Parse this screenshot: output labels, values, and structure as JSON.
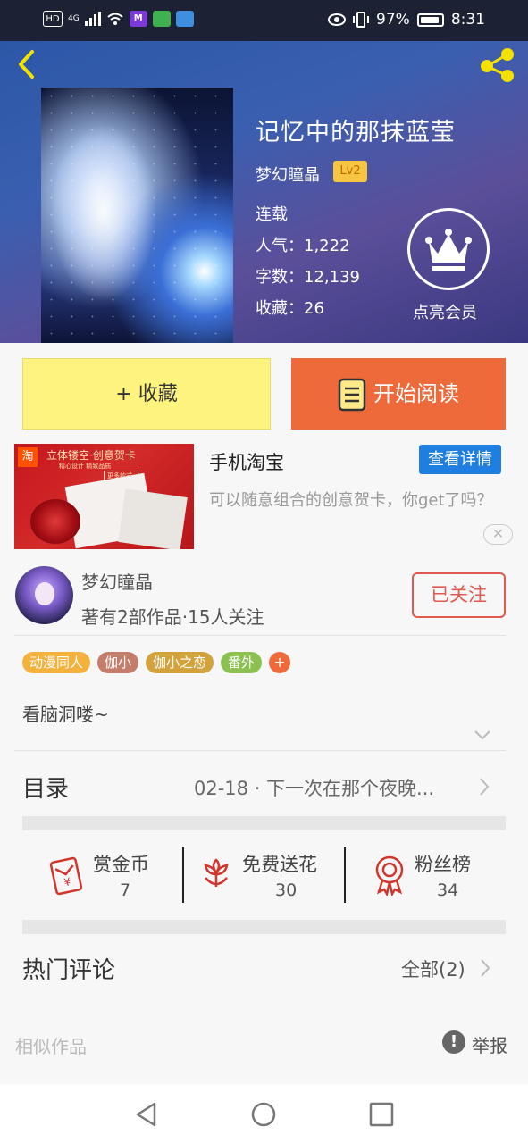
{
  "status_bar": {
    "network": "HD",
    "signal": "4G",
    "battery": "97%",
    "time": "8:31"
  },
  "book": {
    "title": "记忆中的那抹蓝莹",
    "author": "梦幻瞳晶",
    "level": "Lv2",
    "status": "连载",
    "popularity": "人气：1,222",
    "word_count": "字数：12,139",
    "favorites": "收藏：26",
    "vip_label": "点亮会员"
  },
  "actions": {
    "collect": "+ 收藏",
    "read": "开始阅读"
  },
  "ad": {
    "logo": "淘",
    "banner": "立体镂空·创意贺卡",
    "banner_sub": "精心设计  精致品质",
    "banner_more": "更多款式›",
    "title": "手机淘宝",
    "button": "查看详情",
    "description": "可以随意组合的创意贺卡，你get了吗？",
    "close": "✕"
  },
  "author_card": {
    "name": "梦幻瞳晶",
    "info": "著有2部作品·15人关注",
    "follow": "已关注"
  },
  "tags": [
    {
      "label": "动漫同人",
      "color": "#f4b23c"
    },
    {
      "label": "伽小",
      "color": "#c47d6a"
    },
    {
      "label": "伽小之恋",
      "color": "#d4a23c"
    },
    {
      "label": "番外",
      "color": "#8cc152"
    }
  ],
  "tag_add": "+",
  "description": "看脑洞喽~",
  "toc": {
    "label": "目录",
    "latest": "02-18 · 下一次在那个夜晚..."
  },
  "rewards": [
    {
      "label": "赏金币",
      "value": "7"
    },
    {
      "label": "免费送花",
      "value": "30"
    },
    {
      "label": "粉丝榜",
      "value": "34"
    }
  ],
  "comments": {
    "label": "热门评论",
    "all": "全部(2)"
  },
  "similar": "相似作品",
  "report": "举报",
  "report_icon": "!",
  "colors": {
    "accent_orange": "#ee6a3a",
    "collect_yellow": "#fdf37e",
    "follow_red": "#e15a50",
    "ad_blue": "#1e7fe0",
    "icon_red": "#d0362b"
  }
}
